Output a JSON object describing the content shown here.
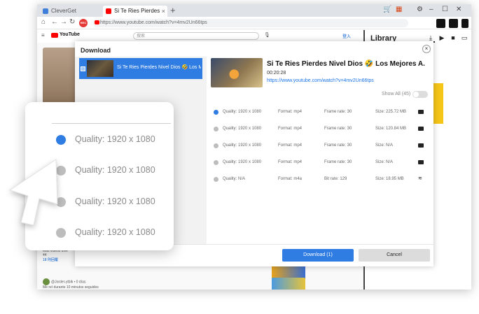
{
  "browser": {
    "tabs": [
      {
        "label": "CleverGet",
        "active": false
      },
      {
        "label": "Si Te Ries Pierdes Nive",
        "active": true
      }
    ],
    "new_tab_icon": "plus-icon",
    "rec_label": "REC",
    "url": "https://www.youtube.com/watch?v=4mv2Un66tps"
  },
  "youtube": {
    "logo": "YouTube",
    "search_placeholder": "搜索",
    "signin": "登入",
    "comments": [
      {
        "text": "Más videos dive",
        "sub": "44"
      },
      {
        "text": "@Jorder-ytblk • 0 días",
        "sub": "Me reí durante 10 minutos seguidos"
      }
    ],
    "replies": "18 則回覆"
  },
  "library": {
    "title": "Library",
    "icons": [
      "download-icon",
      "youtube-icon",
      "video-icon",
      "film-icon"
    ]
  },
  "dialog": {
    "title": "Download",
    "item_name": "Si Te Ries Pierdes Nivel Dios 🤣 Los Mejores A.",
    "video": {
      "title": "Si Te Ries Pierdes Nivel Dios 🤣 Los Mejores A.",
      "duration": "00:20:28",
      "url": "https://www.youtube.com/watch?v=4mv2Un66tps"
    },
    "show_all": "Show All (45)",
    "rows": [
      {
        "quality": "Quality: 1920 x 1080",
        "format": "Format: mp4",
        "frame": "Frame rate: 30",
        "size": "Size: 225.72 MB",
        "selected": true
      },
      {
        "quality": "Quality: 1920 x 1080",
        "format": "Format: mp4",
        "frame": "Frame rate: 30",
        "size": "Size: 120.84 MB",
        "selected": false
      },
      {
        "quality": "Quality: 1920 x 1080",
        "format": "Format: mp4",
        "frame": "Frame rate: 30",
        "size": "Size: N/A",
        "selected": false
      },
      {
        "quality": "Quality: 1920 x 1080",
        "format": "Format: mp4",
        "frame": "Frame rate: 30",
        "size": "Size: N/A",
        "selected": false
      },
      {
        "quality": "Quality: N/A",
        "format": "Format: m4a",
        "frame": "Bit rate: 129",
        "size": "Size: 18.95 MB",
        "selected": false
      }
    ],
    "download_button": "Download (1)",
    "cancel_button": "Cancel"
  },
  "zoom": {
    "rows": [
      {
        "label": "Quality: 1920 x 1080",
        "selected": true
      },
      {
        "label": "Quality: 1920 x 1080",
        "selected": false
      },
      {
        "label": "Quality: 1920 x 1080",
        "selected": false
      },
      {
        "label": "Quality: 1920 x 1080",
        "selected": false
      }
    ]
  },
  "colors": {
    "accent": "#2f7ce2",
    "cancel": "#dcdcdc",
    "youtube_red": "#ff0000"
  }
}
